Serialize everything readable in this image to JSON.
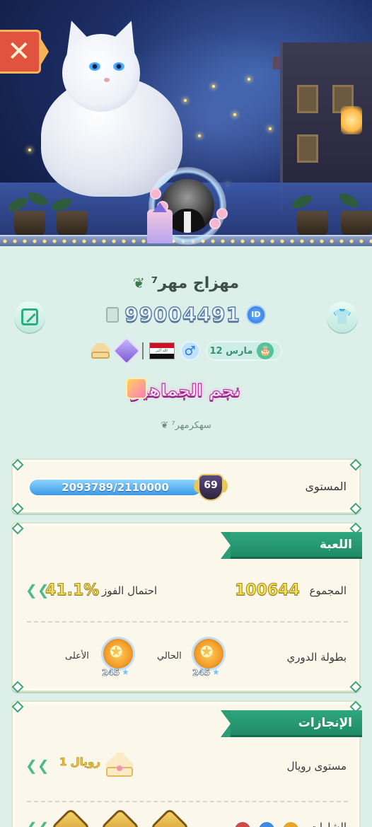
{
  "profile": {
    "name": "مهزاج مهر⁷",
    "id_number": "99004491",
    "id_badge": "ID",
    "birthday": "12 مارس",
    "gender_symbol": "♂",
    "title": "نجم الجماهير",
    "signature": "سهكرمهر⁷"
  },
  "icons": {
    "close": "close-icon",
    "edit": "edit-icon",
    "shirt": "shirt-icon",
    "copy": "copy-icon",
    "crown": "crown-icon",
    "rank": "rank-icon",
    "flag": "iraq-flag-icon",
    "flag_text": "الله أكبر",
    "cake": "cake-icon",
    "cake_glyph": "🎂",
    "shirt_glyph": "👕",
    "chevron": "❮❮"
  },
  "level": {
    "label": "المستوى",
    "progress_text": "2093789/2110000",
    "current": 2093789,
    "max": 2110000,
    "level_number": "69"
  },
  "game": {
    "section_title": "اللعبة",
    "total_label": "المجموع",
    "total_value": "100644",
    "win_rate_label": "احتمال الفوز",
    "win_rate_value": "41.1%",
    "league_label": "بطولة الدوري",
    "current_label": "الحالي",
    "current_level": "245",
    "highest_label": "الأعلى",
    "highest_level": "245"
  },
  "achievements": {
    "section_title": "الإنجازات",
    "royal_label": "مستوى رويال",
    "royal_value": "رويال 1",
    "badges_label": "الشارات"
  },
  "colors": {
    "background": "#dcefe9",
    "accent_green": "#27b07e",
    "ribbon_green": "#1e8a66",
    "progress_blue": "#3a9ae6",
    "gold": "#f4e15a",
    "close_red": "#e2533f"
  }
}
